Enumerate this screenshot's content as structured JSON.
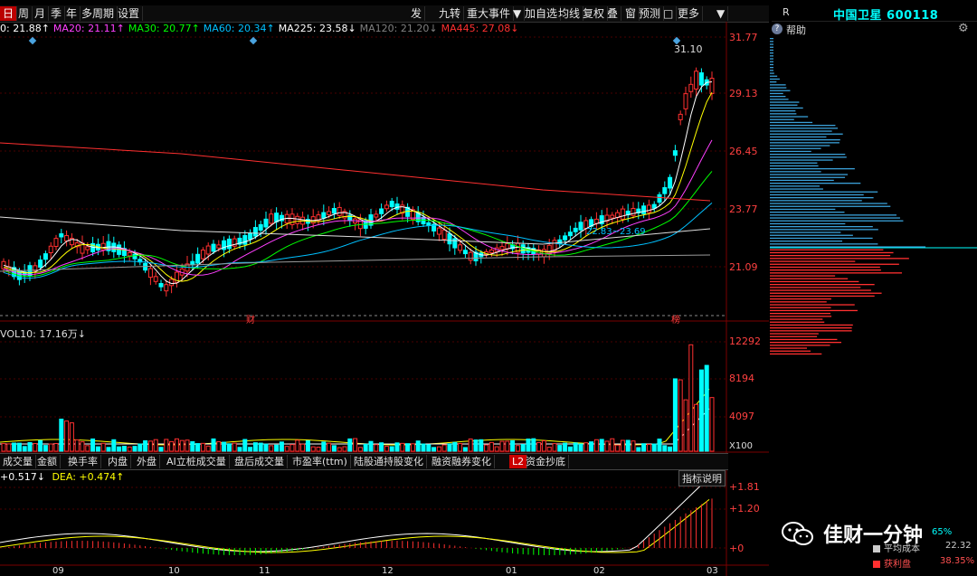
{
  "toolbar": {
    "left_items": [
      "日",
      "周",
      "月",
      "季",
      "年",
      "多周期",
      "设置"
    ],
    "right_items": [
      "发",
      "九转",
      "重大事件",
      "▼",
      "加自选",
      "均线",
      "复权",
      "叠",
      "窗",
      "预测",
      "□",
      "更多",
      "▼"
    ]
  },
  "ma_line": {
    "items": [
      {
        "text": "0: 21.88↑",
        "color": "#ffffff"
      },
      {
        "text": "MA20: 21.11↑",
        "color": "#ff40ff"
      },
      {
        "text": "MA30: 20.77↑",
        "color": "#00ff00"
      },
      {
        "text": "MA60: 20.34↑",
        "color": "#00c0ff"
      },
      {
        "text": "MA225: 23.58↓",
        "color": "#ffffff"
      },
      {
        "text": "MA120: 21.20↓",
        "color": "#808080"
      },
      {
        "text": "MA445: 27.08↓",
        "color": "#ff3030"
      }
    ]
  },
  "price_axis": [
    "31.77",
    "29.13",
    "26.45",
    "23.77",
    "21.09"
  ],
  "annotations": {
    "high_label": "31.10",
    "cost_label": "22.83~23.69",
    "event_cai": "财",
    "event_bang": "榜"
  },
  "volume": {
    "label": "VOL10: 17.16万↓",
    "axis": [
      "12292",
      "8194",
      "4097"
    ],
    "unit": "X100"
  },
  "indicator_tabs": [
    "成交量",
    "金额",
    "换手率",
    "内盘",
    "外盘",
    "AI立桩成交量",
    "盘后成交量",
    "市盈率(ttm)",
    "陆股通持股变化",
    "融资融券变化",
    "L2",
    "资金抄底"
  ],
  "macd": {
    "label1": "+0.517↓",
    "label2": "DEA: +0.474↑",
    "axis": [
      "+1.81",
      "+1.20",
      "+0"
    ],
    "explain_button": "指标说明"
  },
  "x_axis": [
    "09",
    "10",
    "11",
    "12",
    "01",
    "02",
    "03"
  ],
  "right_panel": {
    "code_letter": "R",
    "stock_name": "中国卫星",
    "stock_code": "600118",
    "help_label": "帮助",
    "legend": [
      {
        "label": "平均成本",
        "value": "22.32",
        "color": "#cccccc"
      },
      {
        "label": "获利盘",
        "value": "38.35%",
        "color": "#ff3030"
      }
    ],
    "partial_pct": "65%"
  },
  "watermark": {
    "text": "佳财一分钟"
  },
  "colors": {
    "up": "#ff3030",
    "down": "#00ffff",
    "background": "#000000"
  }
}
